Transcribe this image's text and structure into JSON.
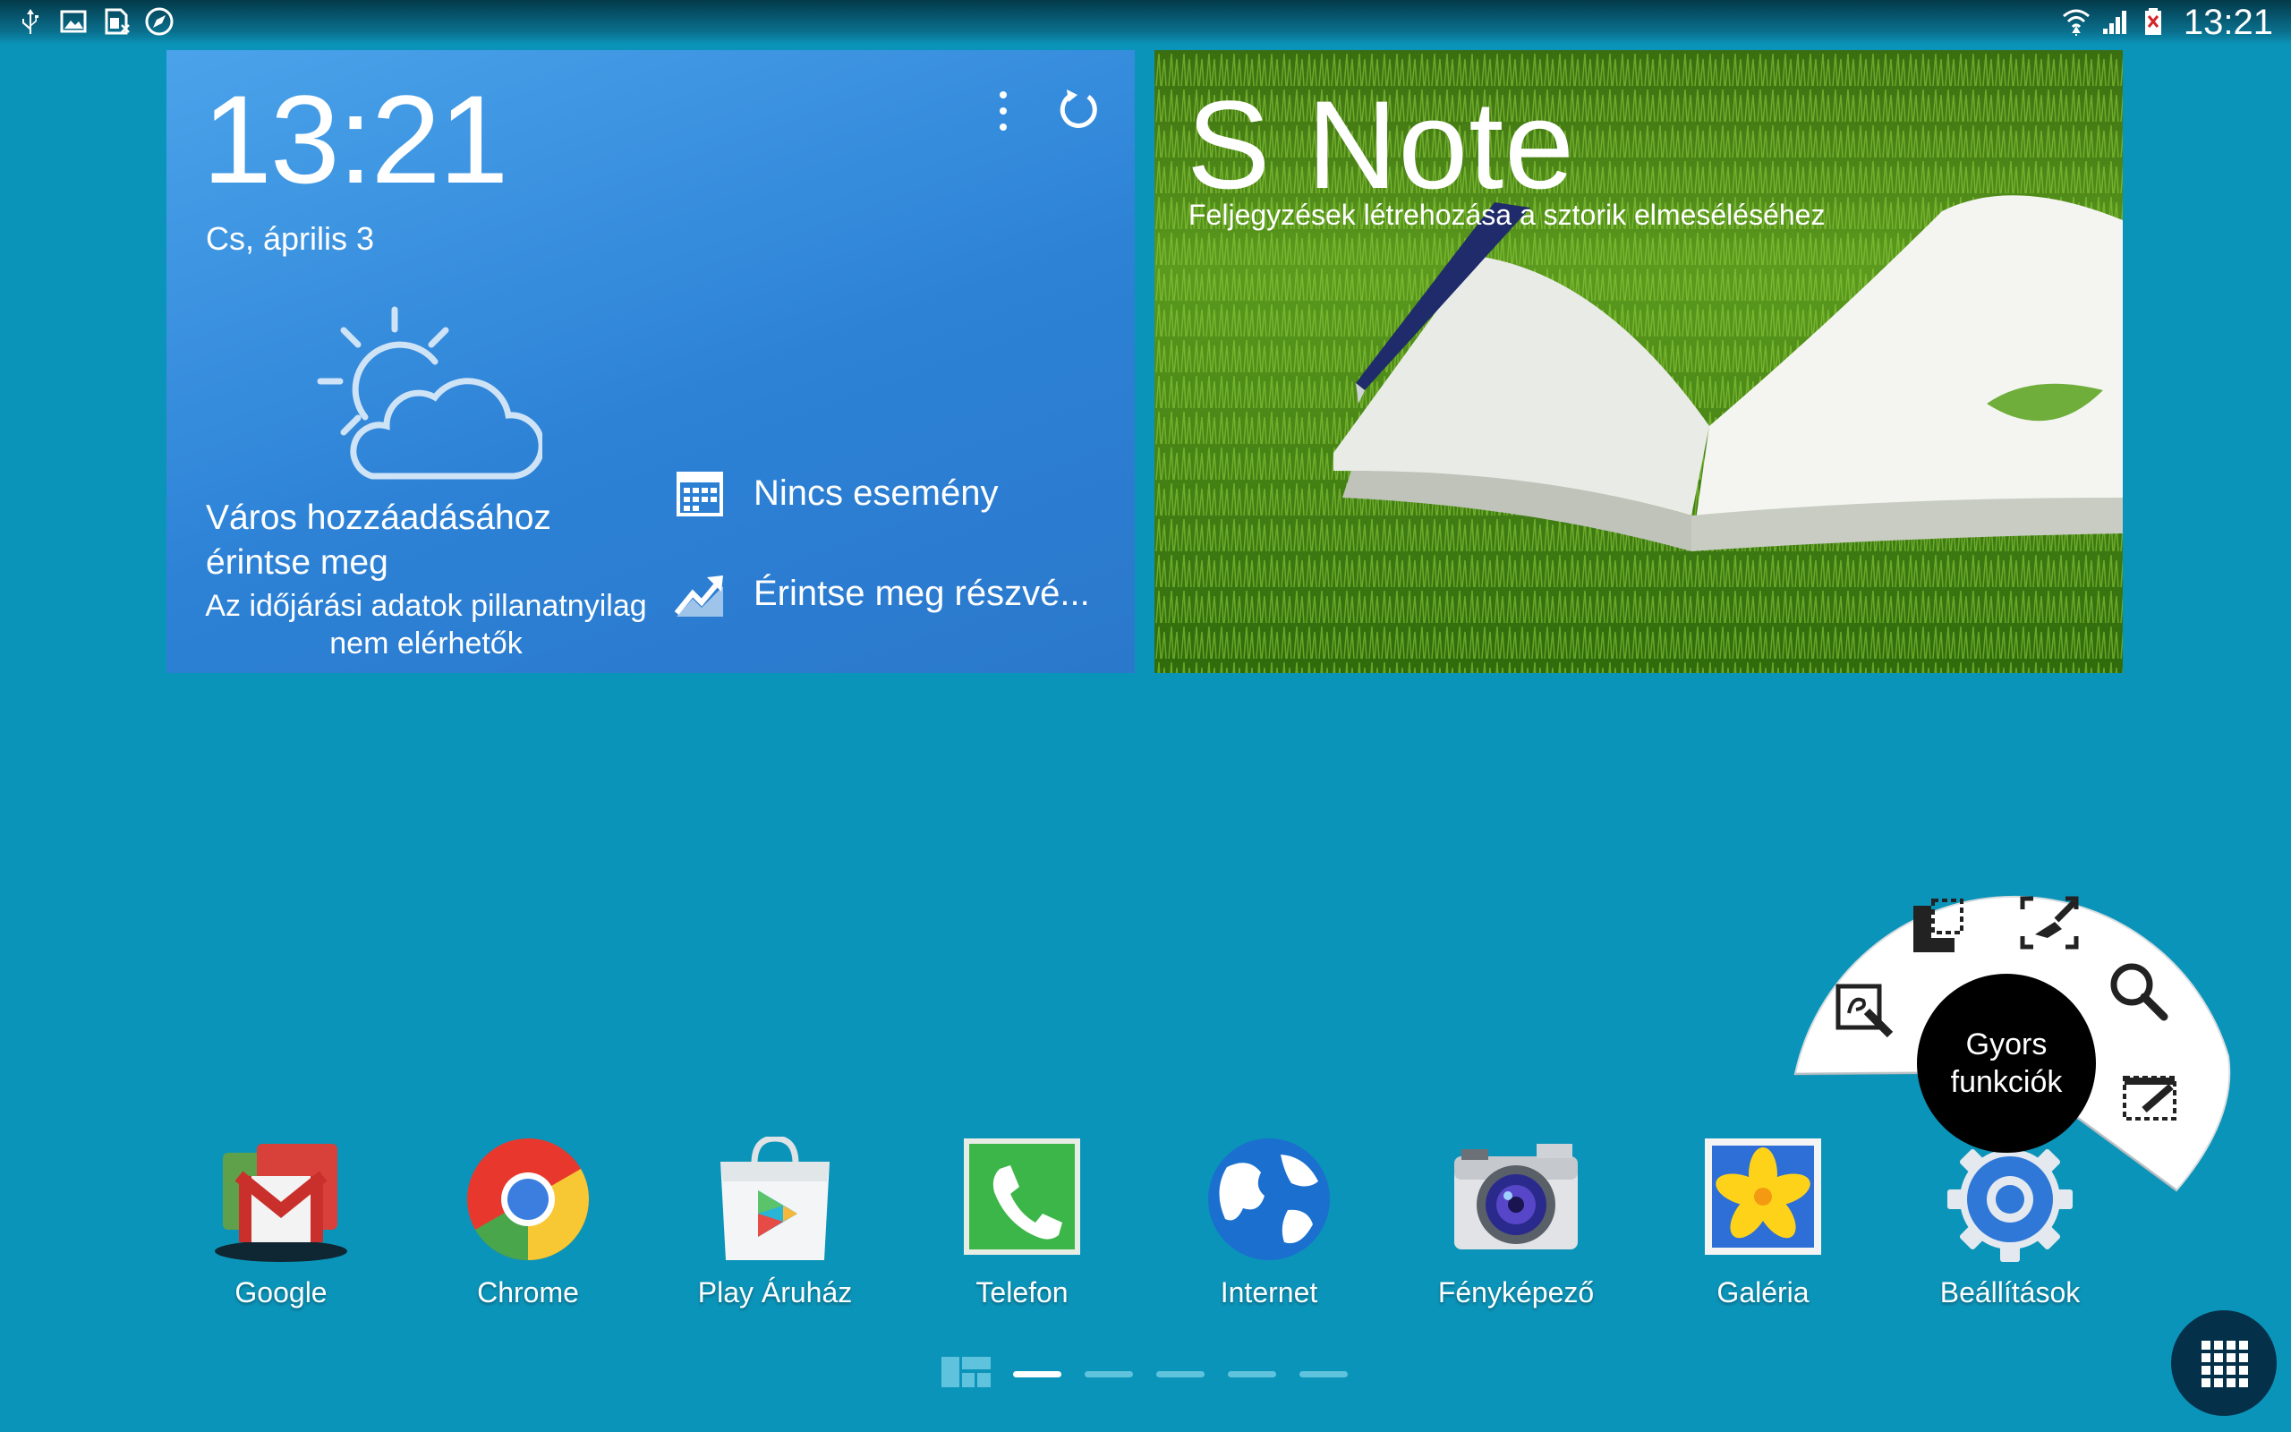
{
  "status_bar": {
    "left_icons": [
      "usb-icon",
      "image-icon",
      "sim-icon",
      "compass-icon"
    ],
    "right_icons": [
      "wifi-icon",
      "signal-icon",
      "battery-icon"
    ],
    "time": "13:21"
  },
  "weather_widget": {
    "time": "13:21",
    "date": "Cs, április 3",
    "city_prompt": "Város hozzáadásához érintse meg",
    "no_data": "Az időjárási adatok pillanatnyilag nem elérhetők",
    "calendar_text": "Nincs esemény",
    "stocks_text": "Érintse meg részvé..."
  },
  "snote_widget": {
    "title": "S Note",
    "subtitle": "Feljegyzések létrehozása a sztorik elmeséléséhez"
  },
  "dock": {
    "apps": [
      {
        "label": "Google",
        "icon": "google-folder-icon"
      },
      {
        "label": "Chrome",
        "icon": "chrome-icon"
      },
      {
        "label": "Play Áruház",
        "icon": "play-store-icon"
      },
      {
        "label": "Telefon",
        "icon": "phone-icon"
      },
      {
        "label": "Internet",
        "icon": "globe-icon"
      },
      {
        "label": "Fényképező",
        "icon": "camera-icon"
      },
      {
        "label": "Galéria",
        "icon": "gallery-icon"
      },
      {
        "label": "Beállítások",
        "icon": "settings-gear-icon"
      }
    ]
  },
  "pages": {
    "count": 5,
    "active_index": 0
  },
  "air_command": {
    "center_label": "Gyors funkciók",
    "actions": [
      "action-memo-icon",
      "scrap-booker-icon",
      "screen-write-icon",
      "s-finder-icon",
      "pen-window-icon"
    ]
  },
  "colors": {
    "background": "#0b94b9",
    "weather_blue": "#2d82d6",
    "status_bar": "#033a4a"
  }
}
